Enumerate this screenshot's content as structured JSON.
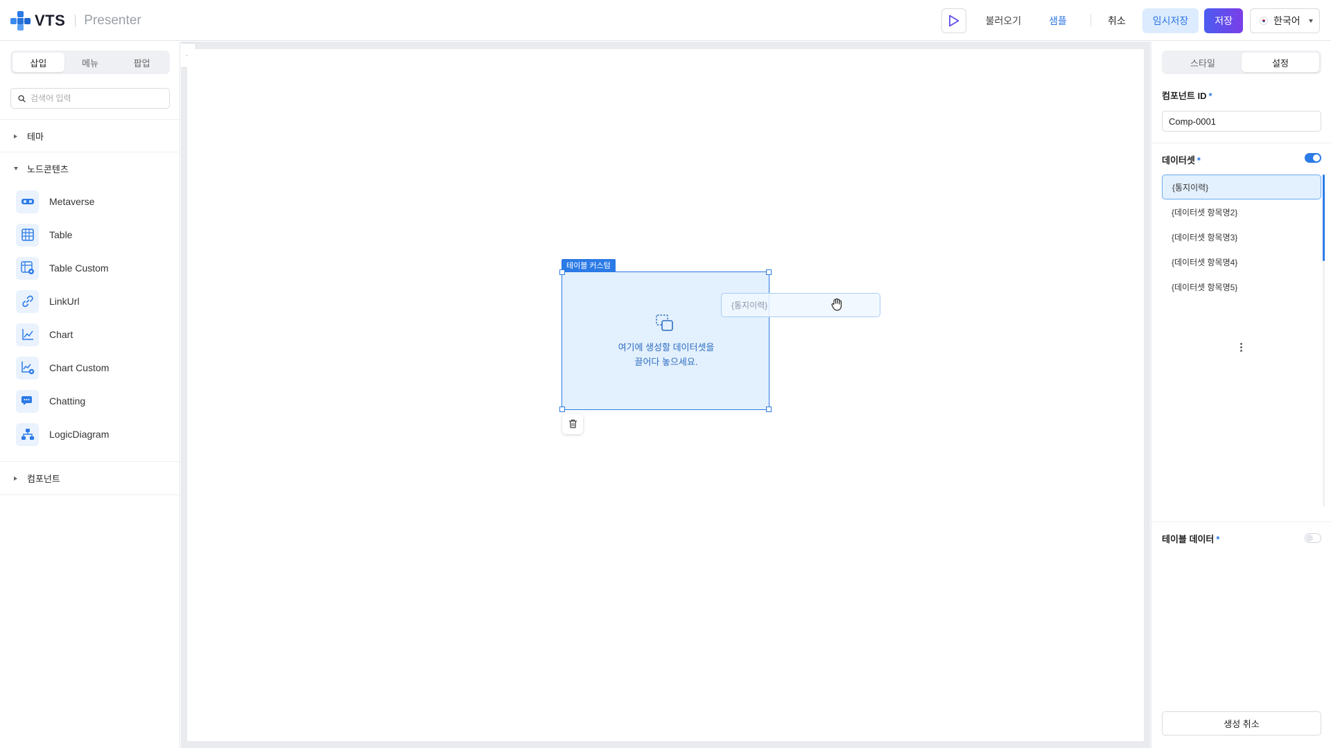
{
  "header": {
    "logo_text": "VTS",
    "product_name": "Presenter",
    "load_label": "불러오기",
    "sample_label": "샘플",
    "cancel_label": "취소",
    "temp_save_label": "임시저장",
    "save_label": "저장",
    "language": "한국어"
  },
  "left_panel": {
    "tabs": [
      {
        "label": "삽입",
        "active": true
      },
      {
        "label": "메뉴",
        "active": false
      },
      {
        "label": "팝업",
        "active": false
      }
    ],
    "search_placeholder": "검색어 입력",
    "sections": {
      "theme": "테마",
      "node_contents": "노드콘텐츠",
      "components": "컴포넌트"
    },
    "node_items": [
      {
        "label": "Metaverse",
        "icon": "metaverse-icon"
      },
      {
        "label": "Table",
        "icon": "table-icon"
      },
      {
        "label": "Table Custom",
        "icon": "table-custom-icon"
      },
      {
        "label": "LinkUrl",
        "icon": "link-icon"
      },
      {
        "label": "Chart",
        "icon": "chart-icon"
      },
      {
        "label": "Chart Custom",
        "icon": "chart-custom-icon"
      },
      {
        "label": "Chatting",
        "icon": "chat-icon"
      },
      {
        "label": "LogicDiagram",
        "icon": "diagram-icon"
      }
    ]
  },
  "canvas": {
    "selected_label": "테이블 커스텀",
    "drop_line1": "여기에 생성할 데이터셋을",
    "drop_line2": "끌어다 놓으세요.",
    "drag_chip": "{통지이력}"
  },
  "right_panel": {
    "tabs": [
      {
        "label": "스타일",
        "active": false
      },
      {
        "label": "설정",
        "active": true
      }
    ],
    "component_id_label": "컴포넌트 ID",
    "component_id_value": "Comp-0001",
    "dataset_label": "데이터셋",
    "dataset_toggle_on": true,
    "datasets": [
      "{통지이력}",
      "{데이터셋 항목명2}",
      "{데이터셋 항목명3}",
      "{데이터셋 항목명4}",
      "{데이터셋 항목명5}"
    ],
    "table_data_label": "테이블 데이터",
    "table_data_toggle_on": false,
    "required_mark": "*",
    "cancel_create_label": "생성 취소"
  },
  "colors": {
    "accent": "#2b7ae6",
    "save_gradient_start": "#4b5cf0",
    "save_gradient_end": "#7b3ee8",
    "selection_fill": "#e3f0fd"
  }
}
